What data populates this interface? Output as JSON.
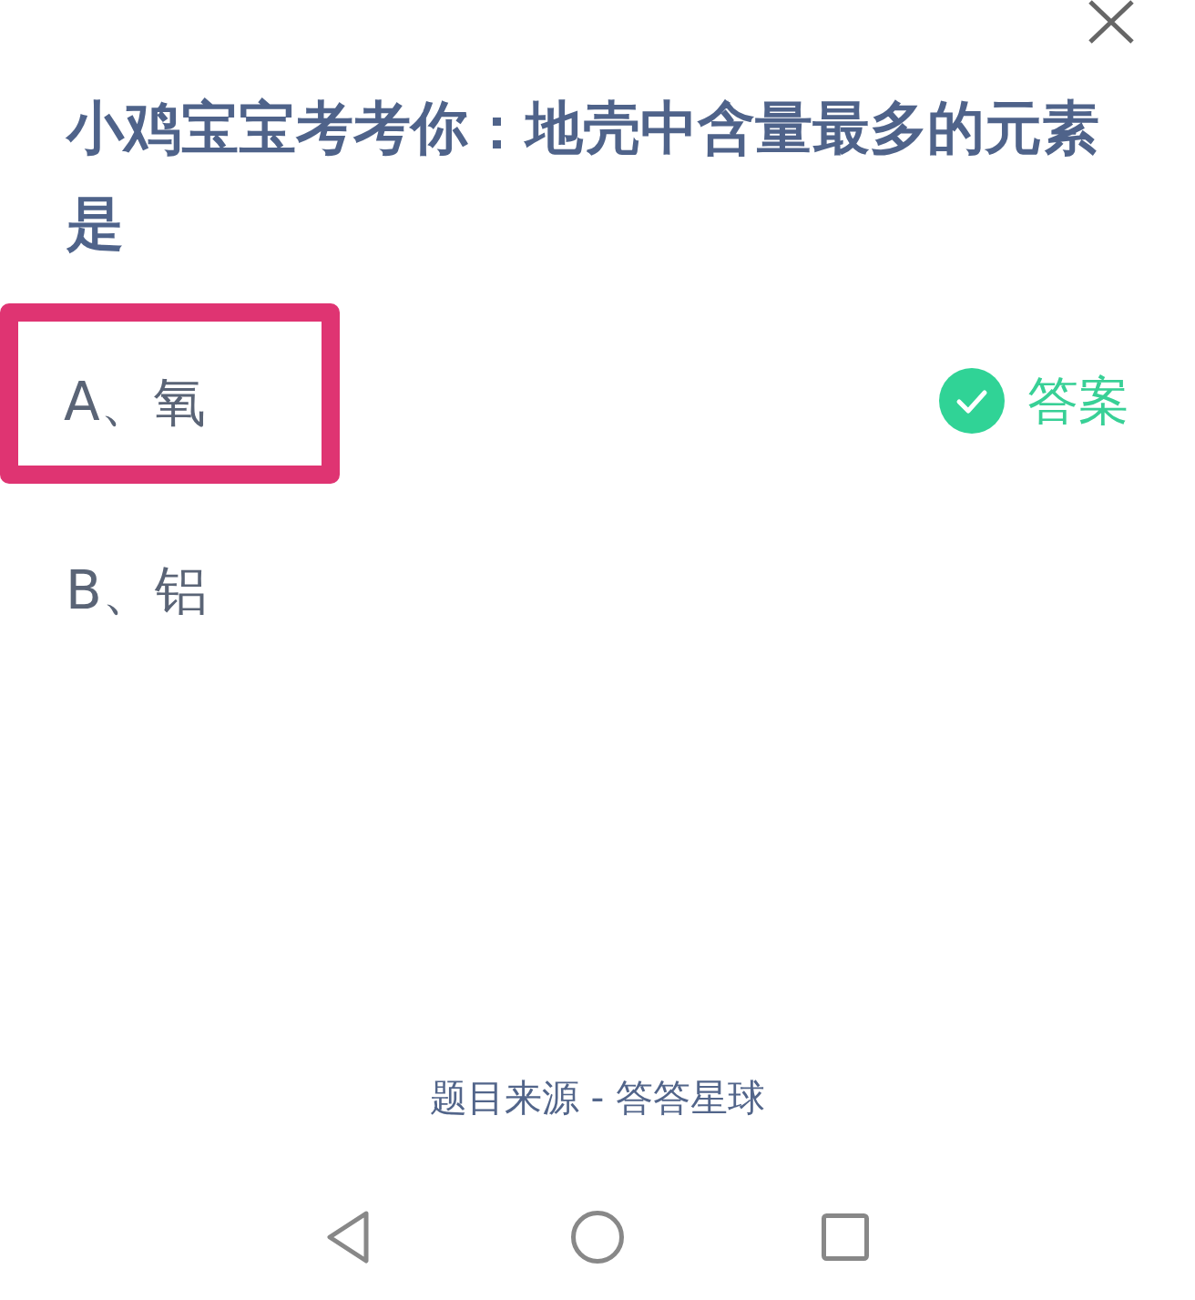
{
  "question": {
    "title": "小鸡宝宝考考你：地壳中含量最多的元素是"
  },
  "options": [
    {
      "label": "A、氧",
      "highlighted": true,
      "answer_badge": {
        "label": "答案"
      }
    },
    {
      "label": "B、铝",
      "highlighted": false
    }
  ],
  "footer": {
    "source": "题目来源 - 答答星球"
  }
}
